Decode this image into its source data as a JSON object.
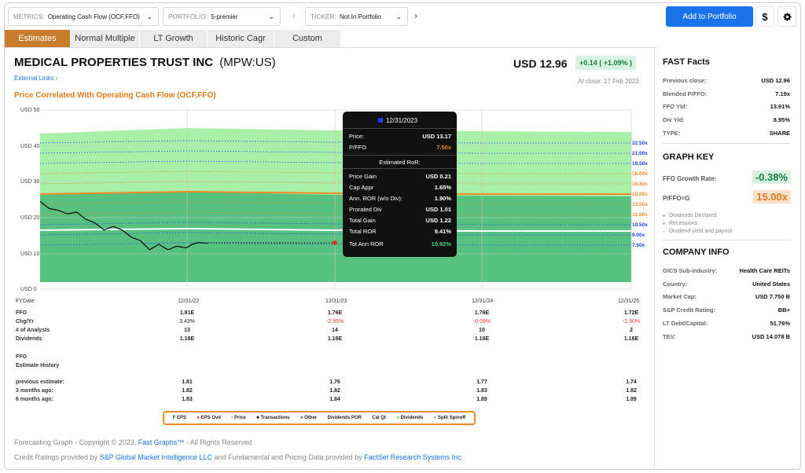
{
  "toolbar": {
    "metrics_label": "METRICS:",
    "metrics_value": "Operating Cash Flow (OCF,FFO)",
    "portfolio_label": "PORTFOLIO:",
    "portfolio_value": "5-premier",
    "ticker_label": "TICKER:",
    "ticker_value": "Not In Portfolio",
    "add_button": "Add to Portfolio",
    "currency_icon": "$"
  },
  "tabs": [
    "Estimates",
    "Normal Multiple",
    "LT Growth",
    "Historic Cagr",
    "Custom"
  ],
  "header": {
    "company": "MEDICAL PROPERTIES TRUST INC",
    "ticker": "(MPW:US)",
    "external_links": "External Links",
    "price": "USD 12.96",
    "change": "+0.14 ( +1.09% )",
    "close_note": "At close: 17 Feb 2023",
    "correlation": "Price Correlated With Operating Cash Flow (OCF,FFO)"
  },
  "chart_data": {
    "type": "line",
    "y_axis_labels": [
      "USD 50",
      "USD 40",
      "USD 30",
      "USD 20",
      "USD 10",
      "USD 0"
    ],
    "ylim": [
      0,
      50
    ],
    "x_labels": [
      "FYDate",
      "12/31/22",
      "12/31/23",
      "12/31/24",
      "12/31/25"
    ],
    "multiples": [
      "22.50x",
      "21.00x",
      "19.50x",
      "18.00x",
      "16.50x",
      "15.00x",
      "13.50x",
      "12.00x",
      "10.50x",
      "9.00x",
      "7.50x"
    ],
    "price_series": {
      "name": "Price",
      "x": [
        0.0,
        0.06,
        0.12,
        0.18,
        0.24,
        0.3,
        0.36,
        0.42,
        0.48,
        0.54,
        0.6,
        0.66,
        0.72,
        0.78,
        0.84,
        0.9,
        0.96,
        1.0,
        1.04,
        1.1
      ],
      "values": [
        24.5,
        22.5,
        22,
        21,
        21.5,
        19.5,
        18.5,
        16.5,
        17.5,
        16.5,
        14.5,
        13.5,
        11,
        12.5,
        11,
        12,
        11.5,
        12.5,
        13,
        12.8
      ]
    }
  },
  "tooltip": {
    "date": "12/31/2023",
    "price_label": "Price:",
    "price": "USD 13.17",
    "pffo_label": "P/FFO",
    "pffo": "7.50x",
    "section": "Estimated RoR:",
    "rows": [
      {
        "label": "Price Gain",
        "value": "USD 0.21"
      },
      {
        "label": "Cap Appr",
        "value": "1.65%"
      },
      {
        "label": "Ann. ROR (w/o Div):",
        "value": "1.90%"
      },
      {
        "label": "Prorated Div",
        "value": "USD 1.01"
      },
      {
        "label": "Total Gain",
        "value": "USD 1.22"
      },
      {
        "label": "Total ROR",
        "value": "9.41%"
      },
      {
        "label": "Tot Ann ROR",
        "value": "10.92%"
      }
    ]
  },
  "table": {
    "rows": [
      {
        "label": "FFO",
        "vals": [
          "1.81E",
          "1.76E",
          "1.76E",
          "1.72E"
        ]
      },
      {
        "label": "Chg/Yr",
        "vals": [
          "3.43%",
          "-2.95%",
          "-0.09%",
          "-1.90%"
        ]
      },
      {
        "label": "# of Analysts",
        "vals": [
          "13",
          "14",
          "10",
          "2"
        ]
      },
      {
        "label": "Dividends",
        "vals": [
          "1.16E",
          "1.16E",
          "1.16E",
          "1.16E"
        ]
      }
    ],
    "history_title_1": "FFO",
    "history_title_2": "Estimate History",
    "history": [
      {
        "label": "previous estimate:",
        "vals": [
          "1.81",
          "1.76",
          "1.77",
          "1.74"
        ]
      },
      {
        "label": "3 months ago:",
        "vals": [
          "1.82",
          "1.82",
          "1.83",
          "1.82"
        ]
      },
      {
        "label": "6 months ago:",
        "vals": [
          "1.83",
          "1.84",
          "1.89",
          "1.89"
        ]
      }
    ]
  },
  "legend": [
    "F EPS",
    "EPS Ovd",
    "- Price",
    "Transactions",
    "Other",
    "Dividends POR",
    "Cal Qt",
    "Dividends",
    "Split Spinoff"
  ],
  "footer": {
    "line1_a": "Forecasting Graph - Copyright © 2023, ",
    "line1_link": "Fast Graphs™",
    "line1_b": " - All Rights Reserved",
    "line2_a": "Credit Ratings provided by ",
    "line2_link1": "S&P Global Market Intelligence LLC",
    "line2_b": " and Fundamental and Pricing Data provided by ",
    "line2_link2": "FactSet Research Systems Inc."
  },
  "fast_facts": {
    "title": "FAST Facts",
    "items": [
      {
        "k": "Previous close:",
        "v": "USD 12.96"
      },
      {
        "k": "Blended P/FFO:",
        "v": "7.19x"
      },
      {
        "k": "FFO Yld:",
        "v": "13.91%"
      },
      {
        "k": "Div Yld:",
        "v": "8.95%"
      },
      {
        "k": "TYPE:",
        "v": "SHARE"
      }
    ]
  },
  "graph_key": {
    "title": "GRAPH KEY",
    "growth_label": "FFO Growth Rate:",
    "growth_value": "-0.38%",
    "pffo_label": "P/FFO=G",
    "pffo_value": "15.00x",
    "notes": [
      "Dividends Declared",
      "Recessions",
      "Dividend yield and payout"
    ]
  },
  "company_info": {
    "title": "COMPANY INFO",
    "items": [
      {
        "k": "GICS Sub-industry:",
        "v": "Health Care REITs"
      },
      {
        "k": "Country:",
        "v": "United States"
      },
      {
        "k": "Market Cap:",
        "v": "USD 7.750 B"
      },
      {
        "k": "S&P Credit Rating:",
        "v": "BB+"
      },
      {
        "k": "LT Debt/Capital:",
        "v": "51.76%"
      },
      {
        "k": "TEV:",
        "v": "USD 14.078 B"
      }
    ]
  }
}
